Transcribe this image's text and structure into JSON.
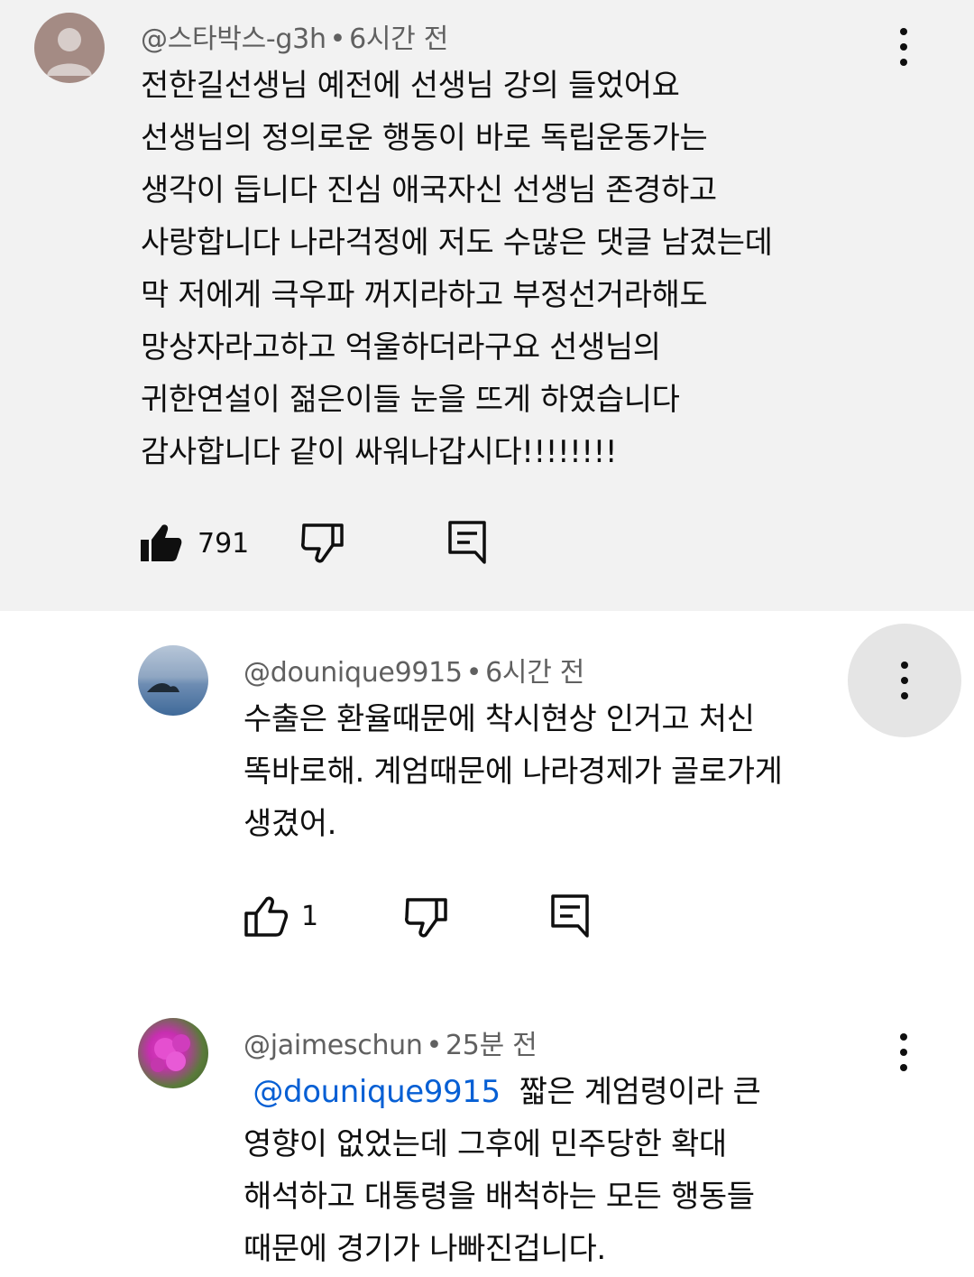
{
  "comment": {
    "author": "@스타박스-g3h",
    "time": "6시간 전",
    "lines": [
      "전한길선생님 예전에 선생님 강의 들었어요",
      "선생님의 정의로운 행동이 바로 독립운동가는",
      "생각이 듭니다 진심 애국자신 선생님 존경하고",
      "사랑합니다 나라걱정에 저도 수많은 댓글 남겼는데",
      "막 저에게 극우파 꺼지라하고 부정선거라해도",
      "망상자라고하고 억울하더라구요  선생님의",
      "귀한연설이 젊은이들 눈을 뜨게 하였습니다",
      "감사합니다 같이 싸워나갑시다!!!!!!!!"
    ],
    "likes": "791",
    "liked": true
  },
  "replies": [
    {
      "author": "@dounique9915",
      "time": "6시간 전",
      "lines": [
        "수출은 환율때문에 착시현상 인거고 처신",
        "똑바로해. 계엄때문에 나라경제가 골로가게",
        "생겼어."
      ],
      "likes": "1"
    },
    {
      "author": "@jaimeschun",
      "time": "25분 전",
      "mention": "@dounique9915",
      "first_line_rest": "짧은 계엄령이라 큰",
      "lines": [
        "영향이 없었는데 그후에 민주당한 확대",
        "해석하고 대통령을 배척하는 모든 행동들",
        "때문에 경기가 나빠진겁니다."
      ]
    }
  ],
  "separator": "•",
  "icons": [
    "person-avatar-icon",
    "more-vert-icon",
    "thumb-up-filled-icon",
    "thumb-up-outline-icon",
    "thumb-down-outline-icon",
    "reply-comment-icon"
  ],
  "colors": {
    "highlight_bg": "#f2f2f2",
    "meta_gray": "#606060",
    "mention_blue": "#065fd4",
    "menu_circle": "#e5e5e5"
  }
}
